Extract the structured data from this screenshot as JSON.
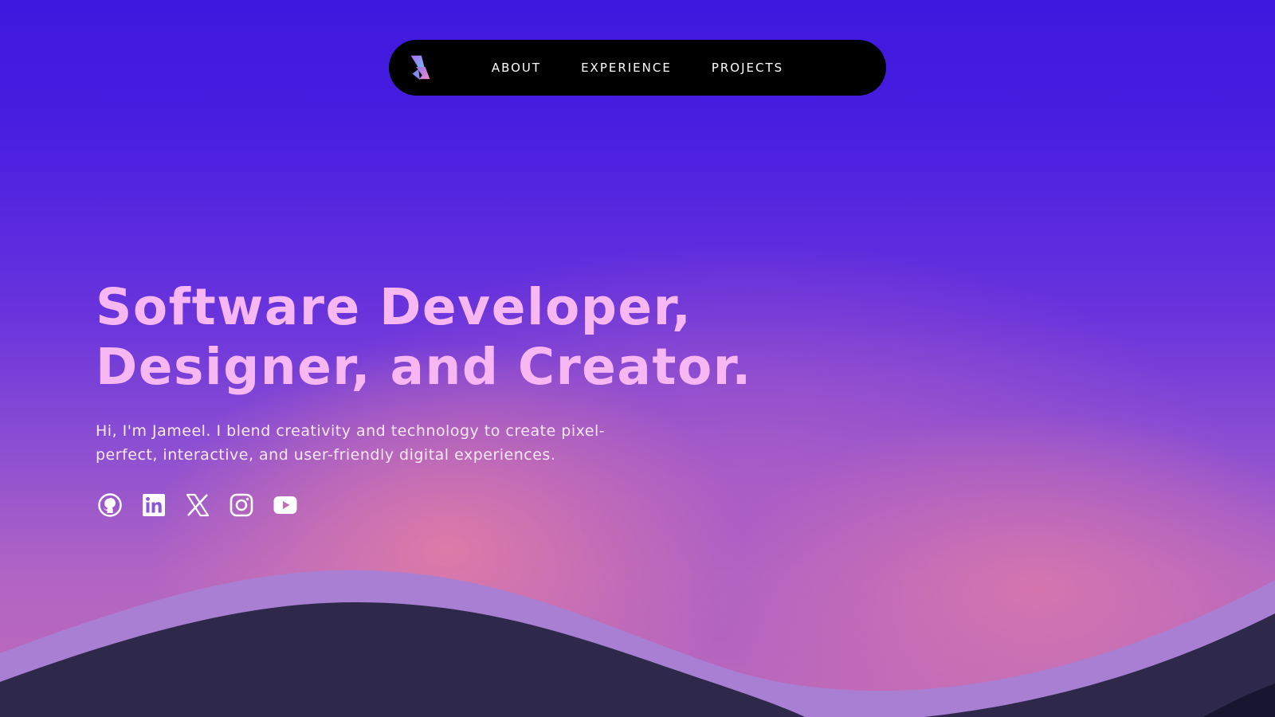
{
  "nav": {
    "logo": "brand-logo",
    "links": [
      "ABOUT",
      "EXPERIENCE",
      "PROJECTS"
    ]
  },
  "hero": {
    "title_line1": "Software Developer,",
    "title_line2": "Designer, and Creator.",
    "subtitle": "Hi, I'm Jameel. I blend creativity and technology to create pixel-perfect, interactive, and user-friendly digital experiences."
  },
  "socials": [
    "github-icon",
    "linkedin-icon",
    "x-icon",
    "instagram-icon",
    "youtube-icon"
  ],
  "colors": {
    "background_top": "#3d18de",
    "title": "#f7b7f2",
    "nav_bg": "#000000",
    "wave_light": "#a97fd3",
    "wave_dark": "#2e294b"
  }
}
